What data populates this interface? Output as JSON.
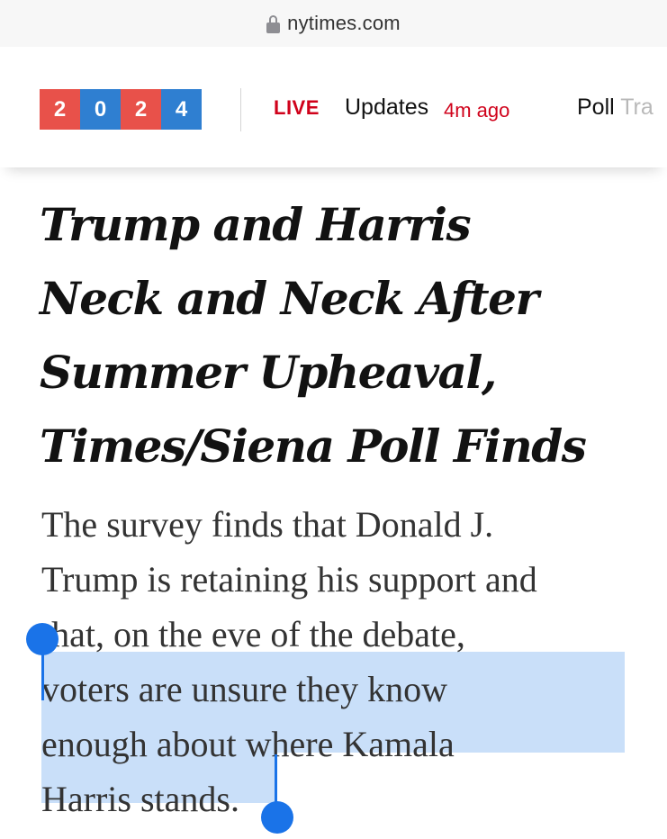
{
  "browser": {
    "url": "nytimes.com"
  },
  "nav": {
    "year_digits": [
      {
        "digit": "2",
        "color": "#e8514a"
      },
      {
        "digit": "0",
        "color": "#2f7fd1"
      },
      {
        "digit": "2",
        "color": "#e8514a"
      },
      {
        "digit": "4",
        "color": "#2f7fd1"
      }
    ],
    "live_label": "LIVE",
    "updates_label": "Updates",
    "time_ago": "4m ago",
    "poll_tracker_label": "Poll Tra"
  },
  "article": {
    "headline_lines": [
      "Trump and Harris",
      "Neck and Neck After",
      "Summer Upheaval,",
      "Times/Siena Poll Finds"
    ],
    "summary_lines": [
      "The survey finds that Donald J.",
      "Trump is retaining his support and",
      "that, on the eve of the debate,",
      "voters are unsure they know",
      "enough about where Kamala",
      "Harris stands."
    ]
  },
  "selection": {
    "selected_text": "voters are unsure they know enough about where Kamala Harris stands.",
    "highlight_color": "#c9dff9",
    "handle_color": "#1a73e8"
  }
}
